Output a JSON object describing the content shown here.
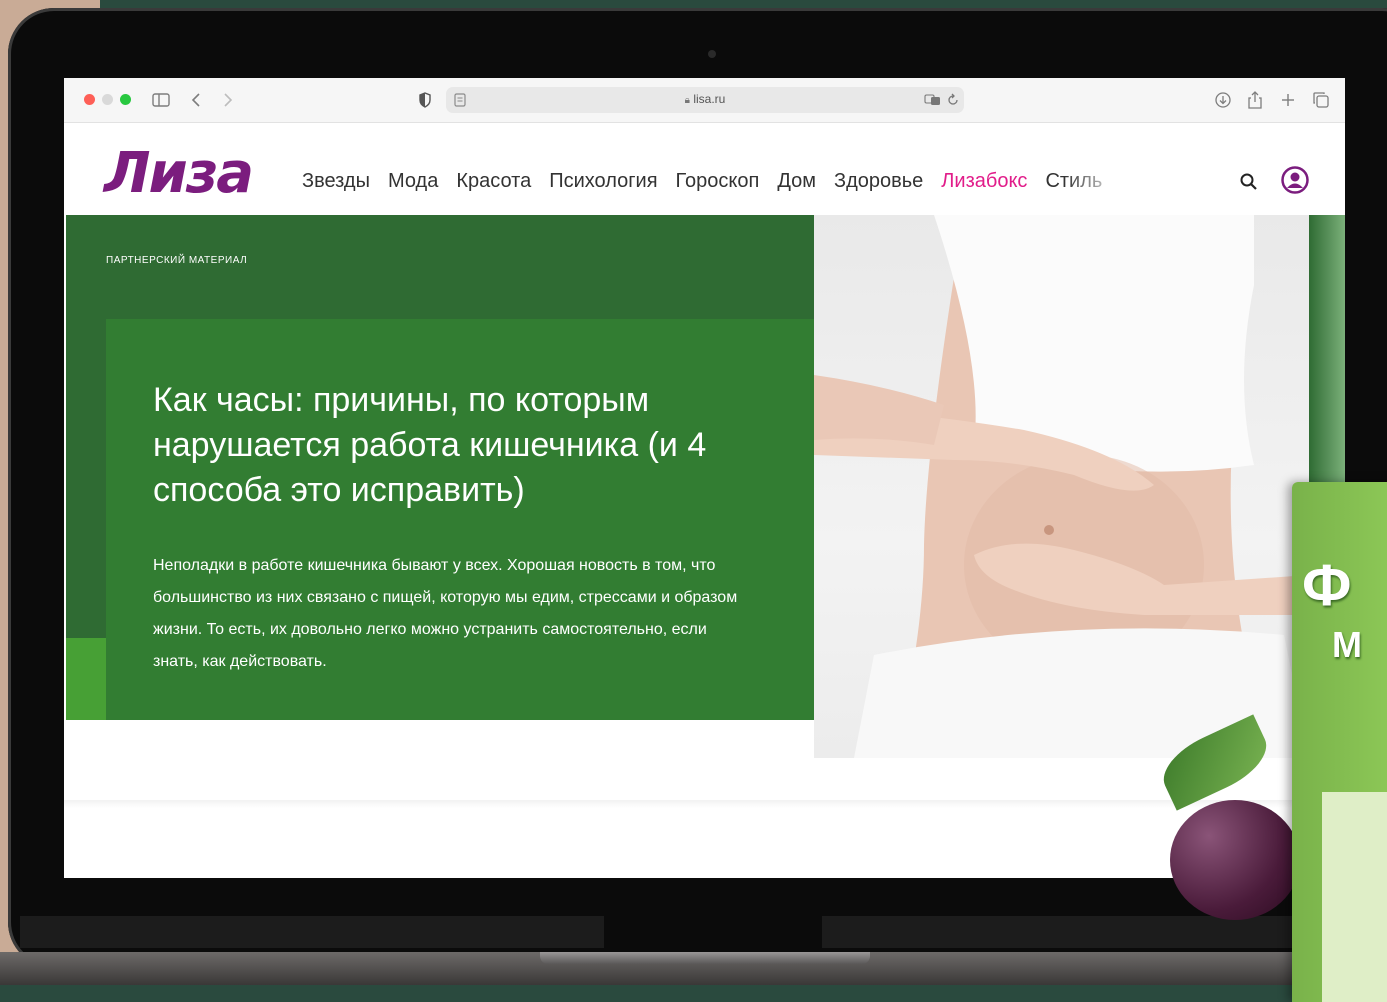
{
  "browser": {
    "url": "lisa.ru"
  },
  "site": {
    "logo": "Лиза",
    "nav": [
      {
        "label": "Звезды",
        "highlight": false
      },
      {
        "label": "Мода",
        "highlight": false
      },
      {
        "label": "Красота",
        "highlight": false
      },
      {
        "label": "Психология",
        "highlight": false
      },
      {
        "label": "Гороскоп",
        "highlight": false
      },
      {
        "label": "Дом",
        "highlight": false
      },
      {
        "label": "Здоровье",
        "highlight": false
      },
      {
        "label": "Лизабокс",
        "highlight": true
      },
      {
        "label": "Стиль",
        "highlight": false
      }
    ],
    "colors": {
      "logo": "#7b1d7e",
      "highlight": "#e11d8a",
      "hero_green": "#327d32"
    }
  },
  "article": {
    "eyebrow": "ПАРТНЕРСКИЙ МАТЕРИАЛ",
    "headline": "Как часы: причины, по которым нарушается работа кишечника (и 4 способа это исправить)",
    "lede": "Неполадки в работе кишечника бывают у всех. Хорошая новость в том, что большинство из них связано с пищей, которую мы едим, стрессами и образом жизни. То есть, их довольно легко можно устранить самостоятельно, если знать, как действовать."
  },
  "product": {
    "brand_partial": "Ф",
    "sub_partial": "М"
  },
  "icons": {
    "sidebar": "sidebar-icon",
    "back": "chevron-left-icon",
    "forward": "chevron-right-icon",
    "shield": "shield-icon",
    "reader": "reader-icon",
    "lock": "lock-icon",
    "translate": "translate-icon",
    "reload": "reload-icon",
    "download": "download-icon",
    "share": "share-icon",
    "new_tab": "plus-icon",
    "tabs": "tabs-icon",
    "search": "search-icon",
    "profile": "user-icon"
  }
}
